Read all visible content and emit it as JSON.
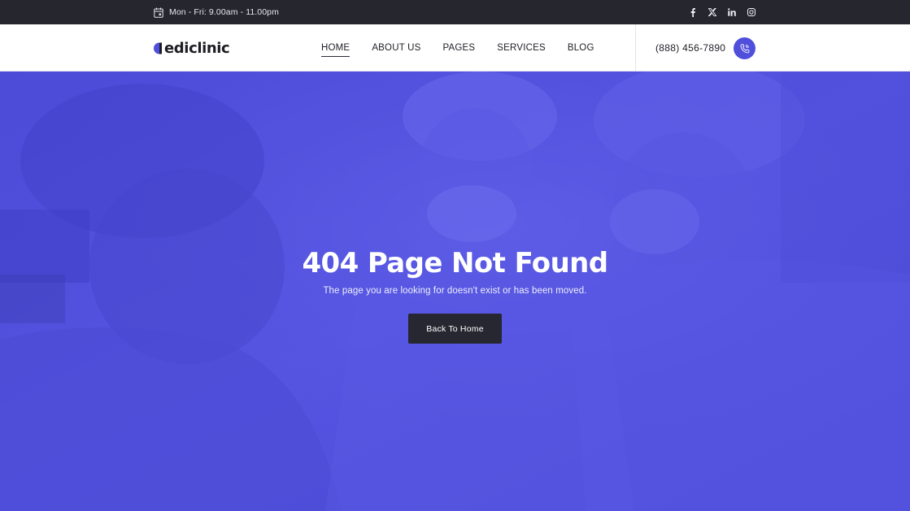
{
  "topbar": {
    "hours": "Mon - Fri:  9.00am - 11.00pm",
    "socials": [
      {
        "icon": "facebook-icon"
      },
      {
        "icon": "x-twitter-icon"
      },
      {
        "icon": "linkedin-icon"
      },
      {
        "icon": "instagram-icon"
      }
    ]
  },
  "header": {
    "logo_text": "ediclinic",
    "nav": [
      {
        "label": "HOME",
        "active": true
      },
      {
        "label": "ABOUT US",
        "active": false
      },
      {
        "label": "PAGES",
        "active": false
      },
      {
        "label": "SERVICES",
        "active": false
      },
      {
        "label": "BLOG",
        "active": false
      }
    ],
    "phone": "(888) 456-7890"
  },
  "hero": {
    "title": "404 Page Not Found",
    "subtitle": "The page you are looking for doesn't exist or has been moved.",
    "button_label": "Back To Home"
  },
  "colors": {
    "accent": "#4f4fdc",
    "dark": "#26262f",
    "hero_overlay": "#5151df"
  }
}
